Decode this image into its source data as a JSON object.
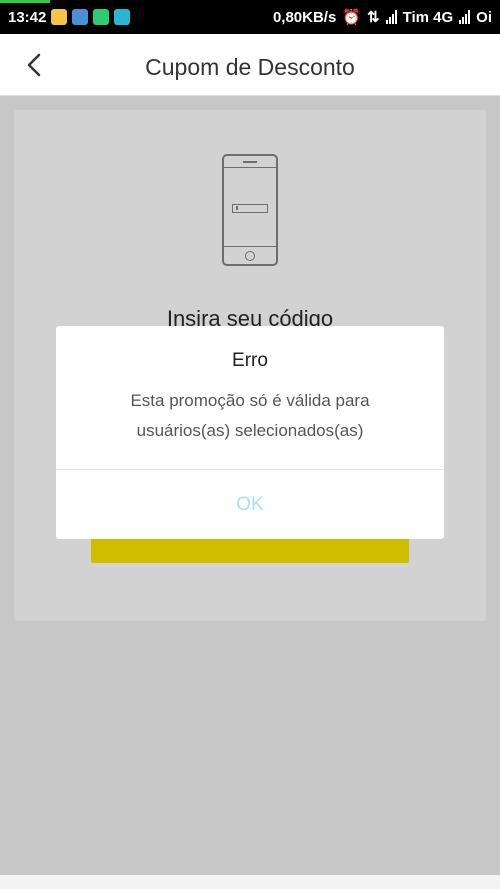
{
  "status_bar": {
    "time": "13:42",
    "speed": "0,80KB/s",
    "carrier1": "Tim 4G",
    "carrier2": "Oi",
    "download_progress": 0.1,
    "icons": [
      "notification-face-icon",
      "notification-app-icon",
      "phone-call-icon",
      "messenger-icon",
      "alarm-icon",
      "data-arrows-icon",
      "signal-icon"
    ],
    "colors": {
      "notif1": "#f5c542",
      "notif2": "#4a90d9",
      "notif3": "#2ecc71",
      "notif4": "#2bb5d4"
    }
  },
  "header": {
    "title": "Cupom de Desconto",
    "back_icon": "chevron-left-icon"
  },
  "card": {
    "illustration": "phone-icon",
    "heading": "Insira seu código"
  },
  "dialog": {
    "title": "Erro",
    "message_line1": "Esta promoção só é válida para",
    "message_line2": "usuários(as) selecionados(as)",
    "ok_label": "OK"
  },
  "colors": {
    "accent_button": "#cfbd00",
    "ok_text": "#a9dff0",
    "overlay": "#c7c7c7"
  }
}
